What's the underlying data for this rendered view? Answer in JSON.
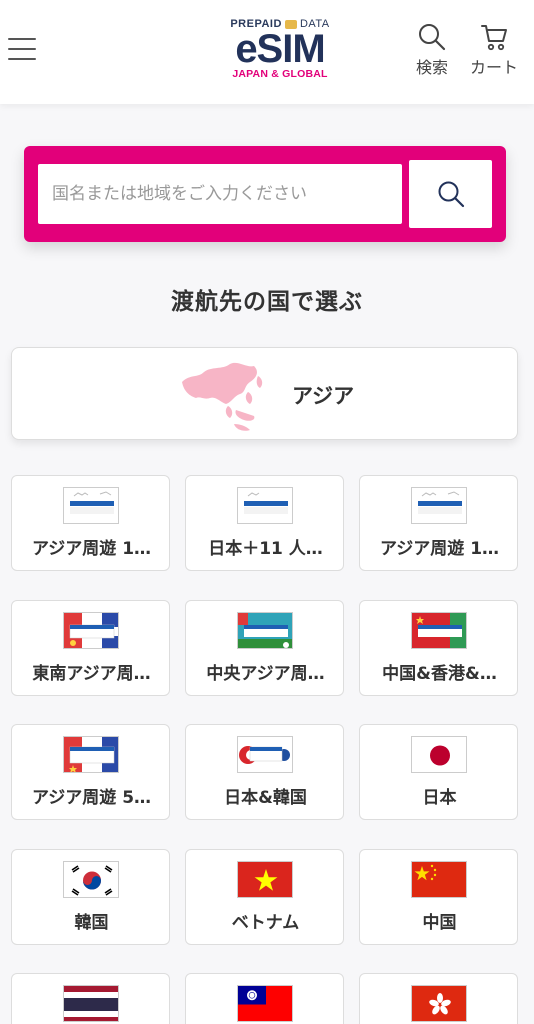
{
  "header": {
    "logo": {
      "top_left": "PREPAID",
      "top_right": "DATA",
      "main": "eSIM",
      "sub": "JAPAN & GLOBAL"
    },
    "search_label": "検索",
    "cart_label": "カート"
  },
  "search": {
    "placeholder": "国名または地域をご入力ください"
  },
  "section_title": "渡航先の国で選ぶ",
  "region": {
    "label": "アジア"
  },
  "tiles": [
    {
      "name": "アジア周遊 1…",
      "thumb": "plan-asia"
    },
    {
      "name": "日本＋11 人…",
      "thumb": "plan-japan11"
    },
    {
      "name": "アジア周遊 1…",
      "thumb": "plan-asia"
    },
    {
      "name": "東南アジア周…",
      "thumb": "plan-sea"
    },
    {
      "name": "中央アジア周…",
      "thumb": "plan-central-asia"
    },
    {
      "name": "中国&香港&…",
      "thumb": "plan-china-hk-macau"
    },
    {
      "name": "アジア周遊 5…",
      "thumb": "plan-asia5"
    },
    {
      "name": "日本&韓国",
      "thumb": "plan-japan-korea"
    },
    {
      "name": "日本",
      "thumb": "flag-japan"
    },
    {
      "name": "韓国",
      "thumb": "flag-korea"
    },
    {
      "name": "ベトナム",
      "thumb": "flag-vietnam"
    },
    {
      "name": "中国",
      "thumb": "flag-china"
    },
    {
      "name": "",
      "thumb": "flag-thailand"
    },
    {
      "name": "",
      "thumb": "flag-taiwan"
    },
    {
      "name": "",
      "thumb": "flag-hongkong"
    }
  ],
  "colors": {
    "brand_pink": "#e2007a",
    "brand_navy": "#22325a"
  }
}
